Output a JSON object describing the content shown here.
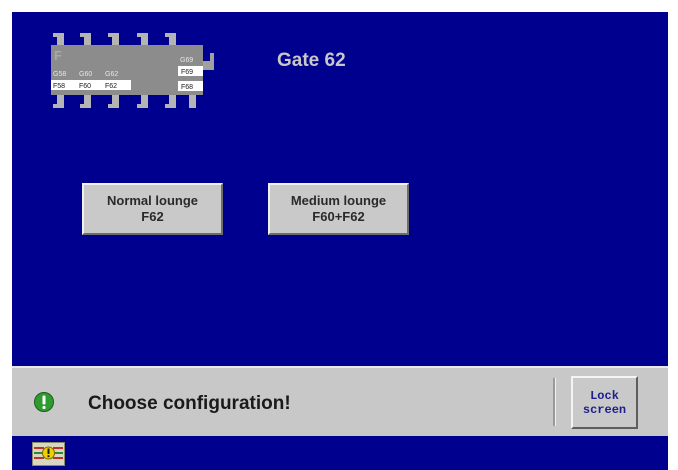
{
  "gate": {
    "title": "Gate 62",
    "map": {
      "terminal_letter": "F",
      "upper_labels": [
        "G58",
        "G60",
        "G62",
        "G69"
      ],
      "lower_labels": [
        "F58",
        "F60",
        "F62",
        "F68"
      ],
      "right_label": "F69"
    }
  },
  "configurations": [
    {
      "line1": "Normal lounge",
      "line2": "F62"
    },
    {
      "line1": "Medium lounge",
      "line2": "F60+F62"
    }
  ],
  "status": {
    "icon": "exclamation-icon",
    "message": "Choose configuration!",
    "lock_line1": "Lock",
    "lock_line2": "screen"
  },
  "bottom": {
    "alarm_icon": "alarm-indicator-icon"
  },
  "colors": {
    "background": "#00008e",
    "button": "#c9c9c9",
    "statusbar": "#c8c8c8",
    "status_icon": "#2f9a2f"
  }
}
